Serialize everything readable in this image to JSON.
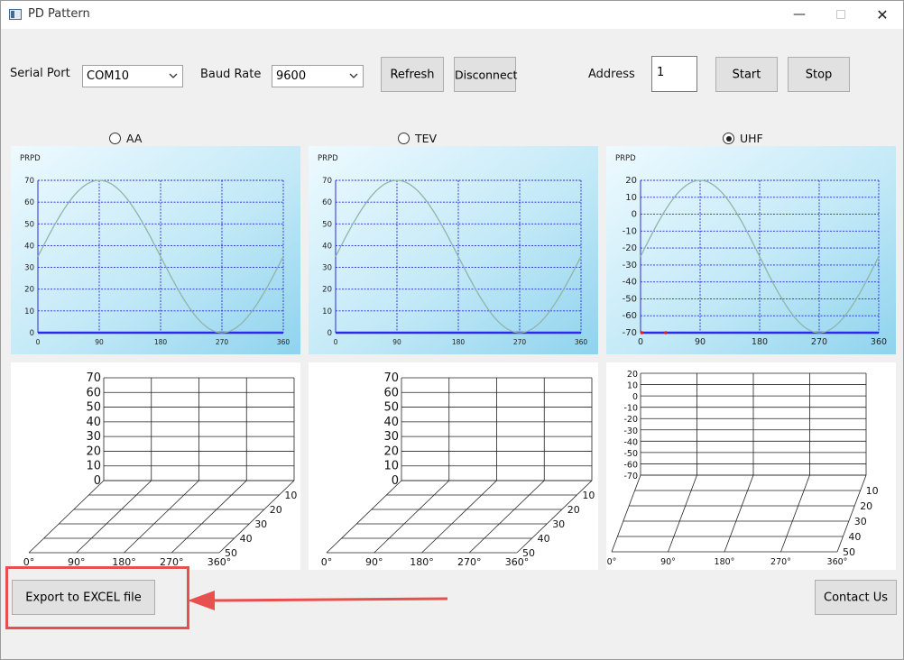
{
  "window": {
    "title": "PD Pattern",
    "minimize": "—",
    "close": "✕"
  },
  "toolbar": {
    "serial_port_label": "Serial Port",
    "serial_port_value": "COM10",
    "baud_rate_label": "Baud Rate",
    "baud_rate_value": "9600",
    "refresh_label": "Refresh",
    "disconnect_label": "Disconnect",
    "address_label": "Address",
    "address_value": "1",
    "start_label": "Start",
    "stop_label": "Stop"
  },
  "modes": [
    {
      "label": "AA",
      "selected": false
    },
    {
      "label": "TEV",
      "selected": false
    },
    {
      "label": "UHF",
      "selected": true
    }
  ],
  "colors": {
    "grid": "#2a2ad6",
    "sine": "#8fb5a8",
    "marker": "#e02020",
    "highlight": "#e8504f"
  },
  "chart_data": [
    {
      "type": "line",
      "title": "PRPD",
      "x_ticks": [
        "0",
        "90",
        "180",
        "270",
        "360"
      ],
      "y_ticks": [
        "0",
        "10",
        "20",
        "30",
        "40",
        "50",
        "60",
        "70"
      ],
      "xlim": [
        0,
        360
      ],
      "ylim": [
        0,
        70
      ],
      "series": [
        {
          "x": [
            0,
            45,
            90,
            135,
            180,
            225,
            270,
            315,
            360
          ],
          "y": [
            35,
            59.7,
            70,
            59.7,
            35,
            10.3,
            0,
            10.3,
            35
          ]
        }
      ],
      "markers": []
    },
    {
      "type": "line",
      "title": "PRPD",
      "x_ticks": [
        "0",
        "90",
        "180",
        "270",
        "360"
      ],
      "y_ticks": [
        "0",
        "10",
        "20",
        "30",
        "40",
        "50",
        "60",
        "70"
      ],
      "xlim": [
        0,
        360
      ],
      "ylim": [
        0,
        70
      ],
      "series": [
        {
          "x": [
            0,
            45,
            90,
            135,
            180,
            225,
            270,
            315,
            360
          ],
          "y": [
            35,
            59.7,
            70,
            59.7,
            35,
            10.3,
            0,
            10.3,
            35
          ]
        }
      ],
      "markers": []
    },
    {
      "type": "line",
      "title": "PRPD",
      "x_ticks": [
        "0",
        "90",
        "180",
        "270",
        "360"
      ],
      "y_ticks": [
        "-70",
        "-60",
        "-50",
        "-40",
        "-30",
        "-20",
        "-10",
        "0",
        "10",
        "20"
      ],
      "xlim": [
        0,
        360
      ],
      "ylim": [
        -70,
        20
      ],
      "series": [
        {
          "x": [
            0,
            45,
            90,
            135,
            180,
            225,
            270,
            315,
            360
          ],
          "y": [
            -25,
            -1.8,
            20,
            -1.8,
            -25,
            -48.2,
            -70,
            -48.2,
            -25
          ]
        }
      ],
      "markers": [
        {
          "x": 2,
          "y": -70
        },
        {
          "x": 38,
          "y": -70
        }
      ]
    }
  ],
  "panels3d": [
    {
      "z_ticks": [
        "0",
        "10",
        "20",
        "30",
        "40",
        "50",
        "60",
        "70"
      ],
      "x_ticks": [
        "0°",
        "90°",
        "180°",
        "270°",
        "360°"
      ],
      "depth_ticks": [
        "10",
        "20",
        "30",
        "40",
        "50"
      ]
    },
    {
      "z_ticks": [
        "0",
        "10",
        "20",
        "30",
        "40",
        "50",
        "60",
        "70"
      ],
      "x_ticks": [
        "0°",
        "90°",
        "180°",
        "270°",
        "360°"
      ],
      "depth_ticks": [
        "10",
        "20",
        "30",
        "40",
        "50"
      ]
    },
    {
      "z_ticks": [
        "-70",
        "-60",
        "-50",
        "-40",
        "-30",
        "-20",
        "-10",
        "0",
        "10",
        "20"
      ],
      "x_ticks": [
        "0°",
        "90°",
        "180°",
        "270°",
        "360°"
      ],
      "depth_ticks": [
        "10",
        "20",
        "30",
        "40",
        "50"
      ]
    }
  ],
  "footer": {
    "export_label": "Export to EXCEL file",
    "contact_label": "Contact Us"
  }
}
